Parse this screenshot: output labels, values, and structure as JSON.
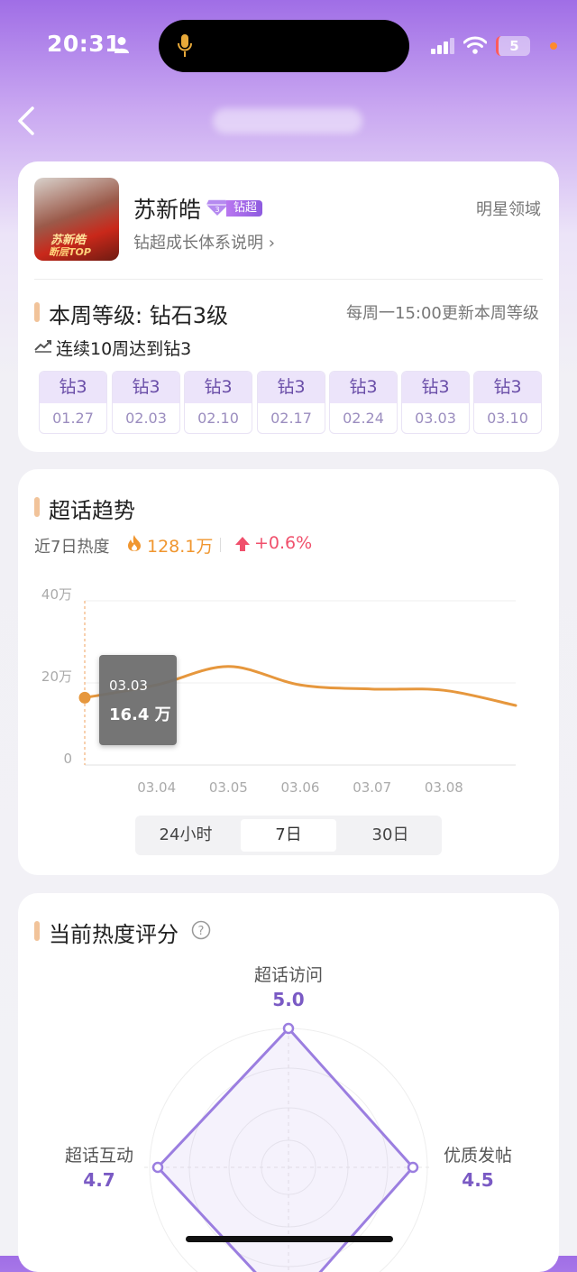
{
  "status_bar": {
    "time": "20:31",
    "battery": "5"
  },
  "profile": {
    "name": "苏新皓",
    "badge_label": "钻超",
    "growth_link": "钻超成长体系说明 ›",
    "domain": "明星领域",
    "avatar_text_1": "苏新皓",
    "avatar_text_2": "断层TOP"
  },
  "week": {
    "level": "本周等级: 钻石3级",
    "update_note": "每周一15:00更新本周等级",
    "streak": "连续10周达到钻3",
    "history": [
      {
        "level": "钻3",
        "date": "01.27"
      },
      {
        "level": "钻3",
        "date": "02.03"
      },
      {
        "level": "钻3",
        "date": "02.10"
      },
      {
        "level": "钻3",
        "date": "02.17"
      },
      {
        "level": "钻3",
        "date": "02.24"
      },
      {
        "level": "钻3",
        "date": "03.03"
      },
      {
        "level": "钻3",
        "date": "03.10"
      }
    ]
  },
  "trend": {
    "title": "超话趋势",
    "heat_label": "近7日热度",
    "heat_value": "128.1万",
    "heat_change": "+0.6%",
    "tooltip_date": "03.03",
    "tooltip_value": "16.4 万",
    "tabs": [
      "24小时",
      "7日",
      "30日"
    ],
    "active_tab": "7日",
    "colors": {
      "line": "#e6973d",
      "accent": "#f0962f",
      "up": "#f0506c"
    }
  },
  "chart_data": {
    "type": "line",
    "y_ticks": [
      "40万",
      "20万",
      "0"
    ],
    "ylim": [
      0,
      40
    ],
    "x_ticks": [
      "03.04",
      "03.05",
      "03.06",
      "03.07",
      "03.08"
    ],
    "series": [
      {
        "x": [
          "03.03",
          "03.04",
          "03.05",
          "03.06",
          "03.07",
          "03.08",
          "03.09"
        ],
        "values": [
          16.4,
          19.5,
          24,
          19.5,
          18.5,
          18.2,
          14.5
        ]
      }
    ]
  },
  "score": {
    "title": "当前热度评分",
    "axes": [
      {
        "label": "超话访问",
        "value": "5.0"
      },
      {
        "label": "优质发帖",
        "value": "4.5"
      },
      {
        "label": "超话互动",
        "value": "4.7"
      }
    ],
    "colors": {
      "radar": "#9b7ee0"
    }
  }
}
